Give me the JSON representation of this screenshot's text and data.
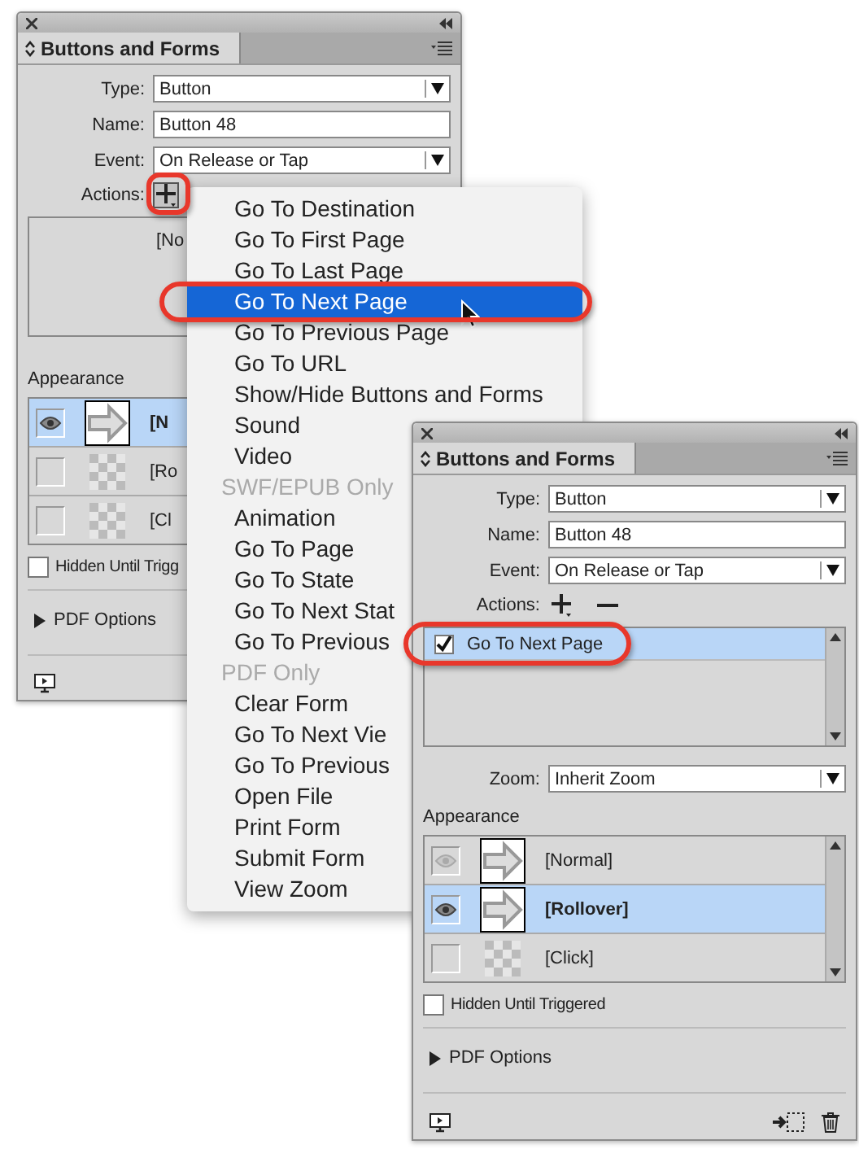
{
  "panels": [
    {
      "title": "Buttons and Forms",
      "fields": [
        {
          "label": "Type:",
          "value": "Button",
          "kind": "dropdown"
        },
        {
          "label": "Name:",
          "value": "Button 48",
          "kind": "text"
        },
        {
          "label": "Event:",
          "value": "On Release or Tap",
          "kind": "dropdown"
        }
      ],
      "actions": {
        "label": "Actions:",
        "buttons": [
          {
            "kind": "add",
            "pressed": true
          }
        ],
        "items": [
          {
            "kind": "note",
            "label": "[No"
          }
        ]
      },
      "appearance": {
        "label": "Appearance",
        "states": [
          {
            "label": "[N",
            "kind": "arrow",
            "eye": true,
            "selected": true
          },
          {
            "label": "[Ro",
            "kind": "empty",
            "eye": false,
            "selected": false
          },
          {
            "label": "[Cl",
            "kind": "empty",
            "eye": false,
            "selected": false
          }
        ]
      },
      "hidden": {
        "label": "Hidden Until Trigg",
        "checked": false
      },
      "pdf_options": {
        "label": "PDF Options",
        "expanded": false
      }
    },
    {
      "title": "Buttons and Forms",
      "fields": [
        {
          "label": "Type:",
          "value": "Button",
          "kind": "dropdown"
        },
        {
          "label": "Name:",
          "value": "Button 48",
          "kind": "text"
        },
        {
          "label": "Event:",
          "value": "On Release or Tap",
          "kind": "dropdown"
        }
      ],
      "actions": {
        "label": "Actions:",
        "buttons": [
          {
            "kind": "add",
            "pressed": false
          },
          {
            "kind": "remove",
            "pressed": false
          }
        ],
        "items": [
          {
            "kind": "action",
            "label": "Go To Next Page",
            "checked": true,
            "selected": true
          }
        ]
      },
      "zoom": {
        "label": "Zoom:",
        "value": "Inherit Zoom"
      },
      "appearance": {
        "label": "Appearance",
        "states": [
          {
            "label": "[Normal]",
            "kind": "arrow",
            "eye": true,
            "selected": false
          },
          {
            "label": "[Rollover]",
            "kind": "arrow",
            "eye": true,
            "selected": true
          },
          {
            "label": "[Click]",
            "kind": "empty",
            "eye": false,
            "selected": false
          }
        ]
      },
      "hidden": {
        "label": "Hidden Until Triggered",
        "checked": false
      },
      "pdf_options": {
        "label": "PDF Options",
        "expanded": false
      }
    }
  ],
  "menu": [
    {
      "label": "Go To Destination",
      "kind": "item",
      "selected": false
    },
    {
      "label": "Go To First Page",
      "kind": "item",
      "selected": false
    },
    {
      "label": "Go To Last Page",
      "kind": "item",
      "selected": false
    },
    {
      "label": "Go To Next Page",
      "kind": "item",
      "selected": true
    },
    {
      "label": "Go To Previous Page",
      "kind": "item",
      "selected": false
    },
    {
      "label": "Go To URL",
      "kind": "item",
      "selected": false
    },
    {
      "label": "Show/Hide Buttons and Forms",
      "kind": "item",
      "selected": false
    },
    {
      "label": "Sound",
      "kind": "item",
      "selected": false
    },
    {
      "label": "Video",
      "kind": "item",
      "selected": false
    },
    {
      "label": "SWF/EPUB Only",
      "kind": "header"
    },
    {
      "label": "Animation",
      "kind": "item",
      "selected": false
    },
    {
      "label": "Go To Page",
      "kind": "item",
      "selected": false
    },
    {
      "label": "Go To State",
      "kind": "item",
      "selected": false
    },
    {
      "label": "Go To Next Stat",
      "kind": "item",
      "selected": false
    },
    {
      "label": "Go To Previous",
      "kind": "item",
      "selected": false
    },
    {
      "label": "PDF Only",
      "kind": "header"
    },
    {
      "label": "Clear Form",
      "kind": "item",
      "selected": false
    },
    {
      "label": "Go To Next Vie",
      "kind": "item",
      "selected": false
    },
    {
      "label": "Go To Previous",
      "kind": "item",
      "selected": false
    },
    {
      "label": "Open File",
      "kind": "item",
      "selected": false
    },
    {
      "label": "Print Form",
      "kind": "item",
      "selected": false
    },
    {
      "label": "Submit Form",
      "kind": "item",
      "selected": false
    },
    {
      "label": "View Zoom",
      "kind": "item",
      "selected": false
    }
  ]
}
